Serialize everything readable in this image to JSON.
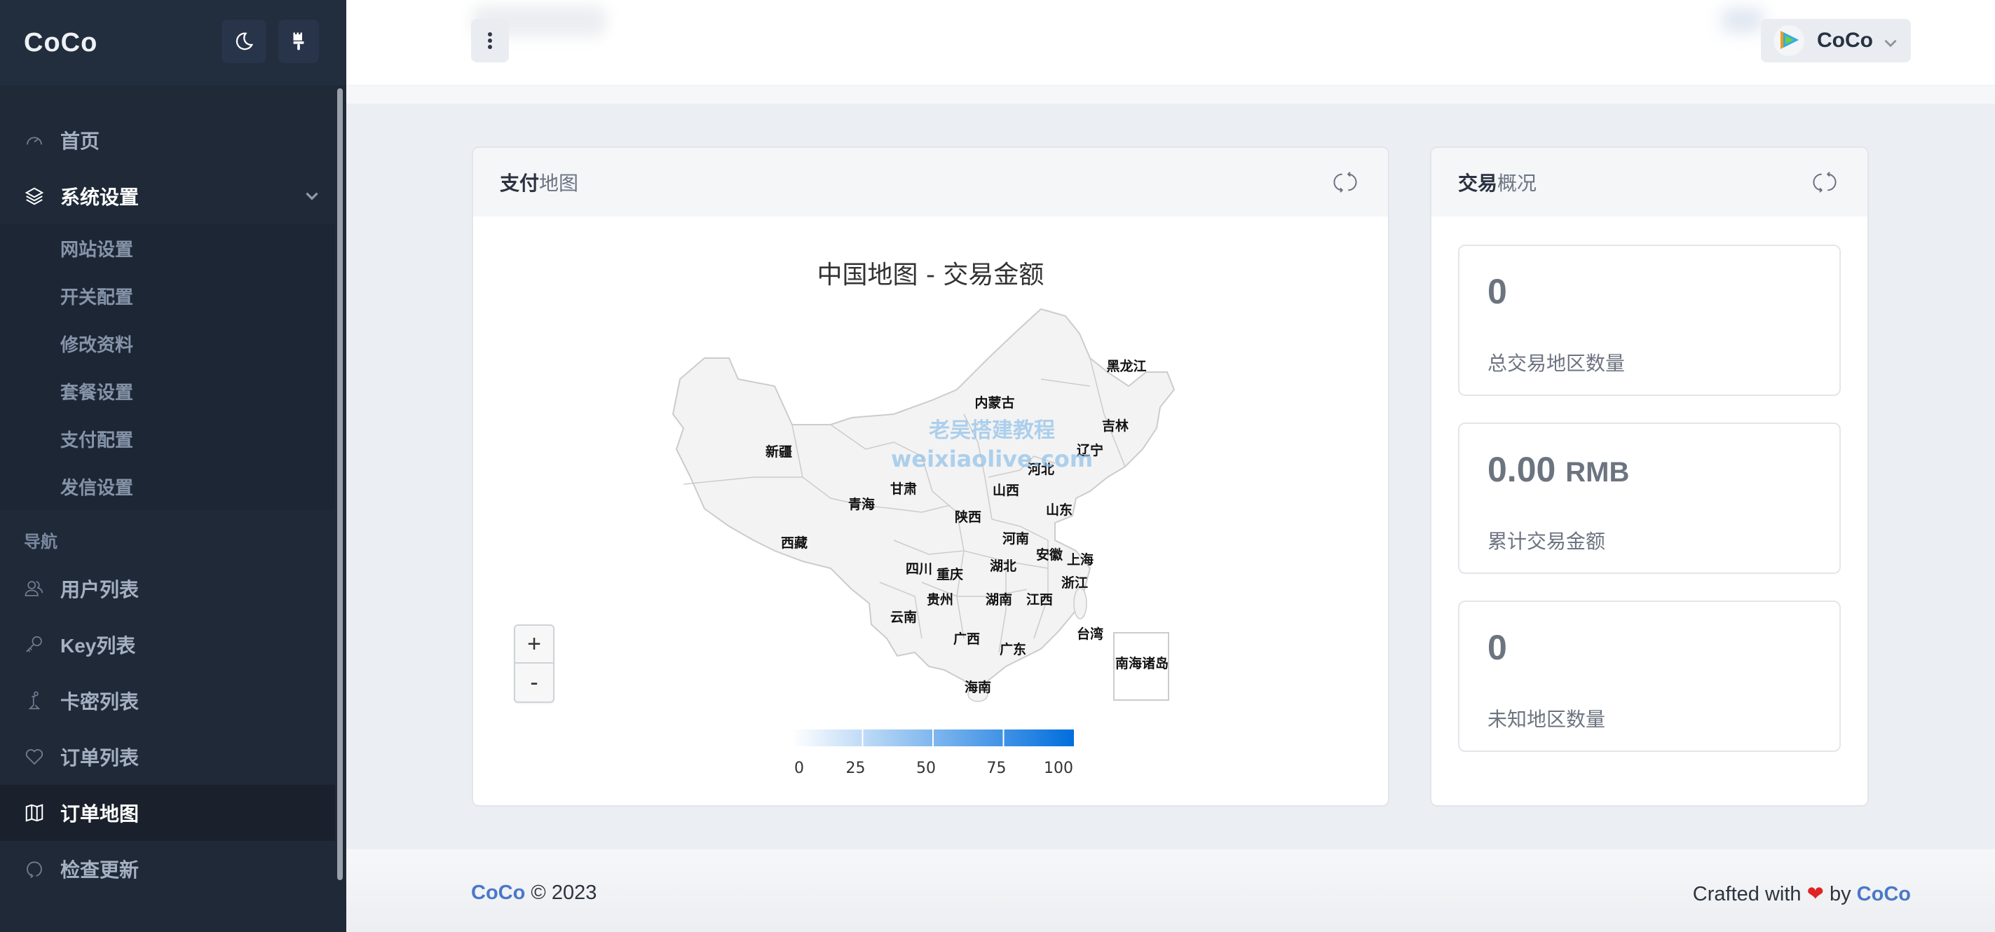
{
  "sidebar": {
    "brand": "CoCo",
    "theme_toggle_icon": "moon-icon",
    "paint_icon": "paintbrush-icon",
    "items": [
      {
        "label": "首页",
        "icon": "dashboard-icon"
      },
      {
        "label": "系统设置",
        "icon": "layers-icon",
        "expanded": true,
        "children": [
          "网站设置",
          "开关配置",
          "修改资料",
          "套餐设置",
          "支付配置",
          "发信设置"
        ]
      }
    ],
    "section_heading": "导航",
    "nav_items": [
      {
        "label": "用户列表",
        "icon": "users-icon"
      },
      {
        "label": "Key列表",
        "icon": "key-icon"
      },
      {
        "label": "卡密列表",
        "icon": "chess-pawn-icon"
      },
      {
        "label": "订单列表",
        "icon": "heart-icon"
      },
      {
        "label": "订单地图",
        "icon": "map-icon",
        "active": true
      },
      {
        "label": "检查更新",
        "icon": "refresh-circle-icon"
      }
    ]
  },
  "header": {
    "menu_icon": "more-vertical-icon",
    "user": {
      "name": "CoCo",
      "avatar_icon": "play-logo-icon"
    }
  },
  "map_card": {
    "title_strong": "支付",
    "title_light": "地图",
    "refresh_icon": "refresh-icon",
    "zoom_in": "+",
    "zoom_out": "-"
  },
  "stats_card": {
    "title_strong": "交易",
    "title_light": "概况",
    "refresh_icon": "refresh-icon",
    "stats": [
      {
        "value": "0",
        "unit": "",
        "label": "总交易地区数量"
      },
      {
        "value": "0.00",
        "unit": "RMB",
        "label": "累计交易金额"
      },
      {
        "value": "0",
        "unit": "",
        "label": "未知地区数量"
      }
    ]
  },
  "chart_data": {
    "type": "heatmap",
    "title": "中国地图 - 交易金额",
    "regions": [
      "黑龙江",
      "内蒙古",
      "吉林",
      "新疆",
      "辽宁",
      "河北",
      "甘肃",
      "山西",
      "青海",
      "陕西",
      "山东",
      "西藏",
      "河南",
      "安徽",
      "上海",
      "四川",
      "湖北",
      "重庆",
      "浙江",
      "贵州",
      "湖南",
      "江西",
      "云南",
      "台湾",
      "广西",
      "广东",
      "南海诸岛",
      "海南"
    ],
    "values": [
      0,
      0,
      0,
      0,
      0,
      0,
      0,
      0,
      0,
      0,
      0,
      0,
      0,
      0,
      0,
      0,
      0,
      0,
      0,
      0,
      0,
      0,
      0,
      0,
      0,
      0,
      0,
      0
    ],
    "visual_map": {
      "min": 0,
      "max": 100,
      "ticks": [
        "0",
        "25",
        "50",
        "75",
        "100"
      ],
      "color_low": "#ffffff",
      "color_high": "#006edd"
    },
    "region_fill": "#f3f3f3",
    "region_border": "#cccccc",
    "watermark": [
      "老吴搭建教程",
      "weixiaolive.com"
    ]
  },
  "footer": {
    "brand": "CoCo",
    "copyright": "© 2023",
    "crafted_prefix": "Crafted with",
    "heart": "❤",
    "crafted_by": "by",
    "crafted_brand": "CoCo"
  },
  "colors": {
    "sidebar_bg": "#1f2937",
    "accent_link": "#4a78c9",
    "heart": "#e02424"
  }
}
